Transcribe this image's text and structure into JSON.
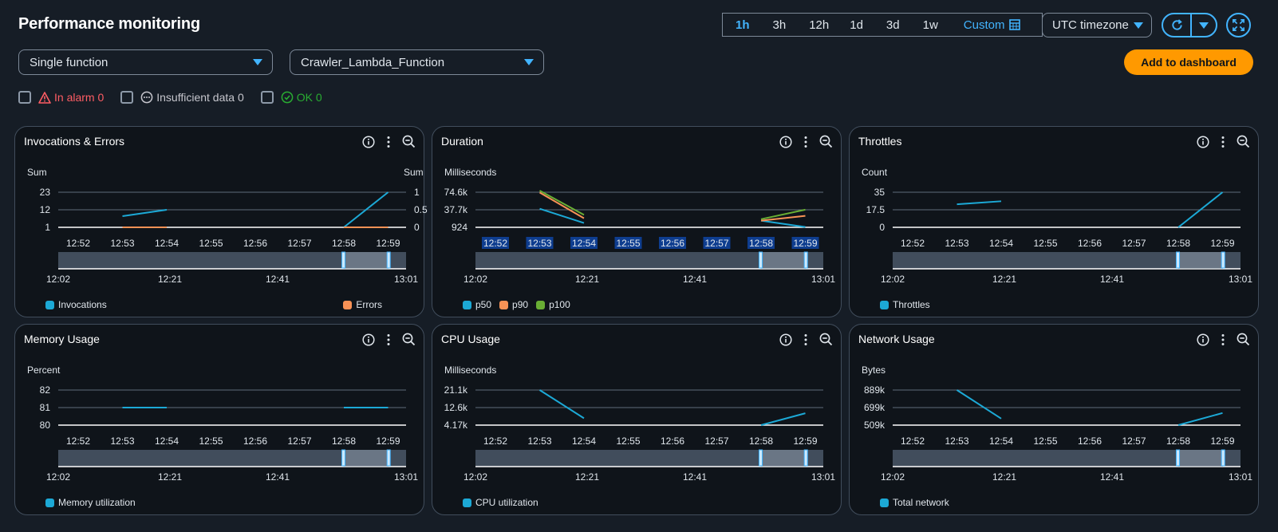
{
  "header": {
    "title": "Performance monitoring",
    "time_ranges": [
      "1h",
      "3h",
      "12h",
      "1d",
      "3d",
      "1w"
    ],
    "active_range": "1h",
    "custom_label": "Custom",
    "timezone": "UTC timezone",
    "add_button": "Add to dashboard"
  },
  "filters": {
    "mode": "Single function",
    "function_name": "Crawler_Lambda_Function"
  },
  "alarm_status": {
    "in_alarm": "In alarm 0",
    "insufficient": "Insufficient data 0",
    "ok": "OK 0"
  },
  "colors": {
    "blue": "#1ca9d6",
    "orange": "#f89256",
    "green": "#69ae34",
    "accent": "#42b4ff",
    "button": "#ff9900"
  },
  "x_ticks": [
    "12:52",
    "12:53",
    "12:54",
    "12:55",
    "12:56",
    "12:57",
    "12:58",
    "12:59"
  ],
  "overview_ticks": [
    "12:02",
    "12:21",
    "12:41",
    "13:01"
  ],
  "panels": [
    {
      "title": "Invocations & Errors",
      "unit": "Sum",
      "unit_right": "Sum",
      "y_ticks": [
        "23",
        "12",
        "1"
      ],
      "y_ticks_right": [
        "1",
        "0.5",
        "0"
      ],
      "legend": [
        "Invocations"
      ],
      "legend_right": "Errors"
    },
    {
      "title": "Duration",
      "unit": "Milliseconds",
      "y_ticks": [
        "74.6k",
        "37.7k",
        "924"
      ],
      "legend": [
        "p50",
        "p90",
        "p100"
      ]
    },
    {
      "title": "Throttles",
      "unit": "Count",
      "y_ticks": [
        "35",
        "17.5",
        "0"
      ],
      "legend": [
        "Throttles"
      ]
    },
    {
      "title": "Memory Usage",
      "unit": "Percent",
      "y_ticks": [
        "82",
        "81",
        "80"
      ],
      "legend": [
        "Memory utilization"
      ]
    },
    {
      "title": "CPU Usage",
      "unit": "Milliseconds",
      "y_ticks": [
        "21.1k",
        "12.6k",
        "4.17k"
      ],
      "legend": [
        "CPU utilization"
      ]
    },
    {
      "title": "Network Usage",
      "unit": "Bytes",
      "y_ticks": [
        "889k",
        "699k",
        "509k"
      ],
      "legend": [
        "Total network"
      ]
    }
  ],
  "chart_data": [
    {
      "type": "line",
      "title": "Invocations & Errors",
      "x": [
        "12:52",
        "12:53",
        "12:54",
        "12:55",
        "12:56",
        "12:57",
        "12:58",
        "12:59"
      ],
      "ylim": [
        1,
        23
      ],
      "ylim_right": [
        0,
        1
      ],
      "ylabel": "Sum",
      "series": [
        {
          "name": "Invocations",
          "color": "#1ca9d6",
          "axis": "left",
          "segments": [
            [
              [
                "12:53",
                8
              ],
              [
                "12:54",
                12
              ]
            ],
            [
              [
                "12:58",
                1
              ],
              [
                "12:59",
                23
              ]
            ]
          ]
        },
        {
          "name": "Errors",
          "color": "#f89256",
          "axis": "right",
          "segments": [
            [
              [
                "12:53",
                0
              ],
              [
                "12:54",
                0
              ]
            ],
            [
              [
                "12:58",
                0
              ],
              [
                "12:59",
                0
              ]
            ]
          ]
        }
      ]
    },
    {
      "type": "line",
      "title": "Duration",
      "x": [
        "12:52",
        "12:53",
        "12:54",
        "12:55",
        "12:56",
        "12:57",
        "12:58",
        "12:59"
      ],
      "ylim": [
        924,
        74600
      ],
      "ylabel": "Milliseconds",
      "series": [
        {
          "name": "p50",
          "color": "#1ca9d6",
          "segments": [
            [
              [
                "12:53",
                40000
              ],
              [
                "12:54",
                10000
              ]
            ],
            [
              [
                "12:58",
                15000
              ],
              [
                "12:59",
                1500
              ]
            ]
          ]
        },
        {
          "name": "p90",
          "color": "#f89256",
          "segments": [
            [
              [
                "12:53",
                74000
              ],
              [
                "12:54",
                20000
              ]
            ],
            [
              [
                "12:58",
                15000
              ],
              [
                "12:59",
                25000
              ]
            ]
          ]
        },
        {
          "name": "p100",
          "color": "#69ae34",
          "segments": [
            [
              [
                "12:53",
                78000
              ],
              [
                "12:54",
                27000
              ]
            ],
            [
              [
                "12:58",
                18000
              ],
              [
                "12:59",
                38000
              ]
            ]
          ]
        }
      ]
    },
    {
      "type": "line",
      "title": "Throttles",
      "x": [
        "12:52",
        "12:53",
        "12:54",
        "12:55",
        "12:56",
        "12:57",
        "12:58",
        "12:59"
      ],
      "ylim": [
        0,
        35
      ],
      "ylabel": "Count",
      "series": [
        {
          "name": "Throttles",
          "color": "#1ca9d6",
          "segments": [
            [
              [
                "12:53",
                23
              ],
              [
                "12:54",
                26
              ]
            ],
            [
              [
                "12:58",
                0
              ],
              [
                "12:59",
                35
              ]
            ]
          ]
        }
      ]
    },
    {
      "type": "line",
      "title": "Memory Usage",
      "x": [
        "12:52",
        "12:53",
        "12:54",
        "12:55",
        "12:56",
        "12:57",
        "12:58",
        "12:59"
      ],
      "ylim": [
        80,
        82
      ],
      "ylabel": "Percent",
      "series": [
        {
          "name": "Memory utilization",
          "color": "#1ca9d6",
          "segments": [
            [
              [
                "12:53",
                81
              ],
              [
                "12:54",
                81
              ]
            ],
            [
              [
                "12:58",
                81
              ],
              [
                "12:59",
                81
              ]
            ]
          ]
        }
      ]
    },
    {
      "type": "line",
      "title": "CPU Usage",
      "x": [
        "12:52",
        "12:53",
        "12:54",
        "12:55",
        "12:56",
        "12:57",
        "12:58",
        "12:59"
      ],
      "ylim": [
        4170,
        21100
      ],
      "ylabel": "Milliseconds",
      "series": [
        {
          "name": "CPU utilization",
          "color": "#1ca9d6",
          "segments": [
            [
              [
                "12:53",
                21100
              ],
              [
                "12:54",
                7500
              ]
            ],
            [
              [
                "12:58",
                4170
              ],
              [
                "12:59",
                9900
              ]
            ]
          ]
        }
      ]
    },
    {
      "type": "line",
      "title": "Network Usage",
      "x": [
        "12:52",
        "12:53",
        "12:54",
        "12:55",
        "12:56",
        "12:57",
        "12:58",
        "12:59"
      ],
      "ylim": [
        509000,
        889000
      ],
      "ylabel": "Bytes",
      "series": [
        {
          "name": "Total network",
          "color": "#1ca9d6",
          "segments": [
            [
              [
                "12:53",
                889000
              ],
              [
                "12:54",
                580000
              ]
            ],
            [
              [
                "12:58",
                509000
              ],
              [
                "12:59",
                640000
              ]
            ]
          ]
        }
      ]
    }
  ]
}
